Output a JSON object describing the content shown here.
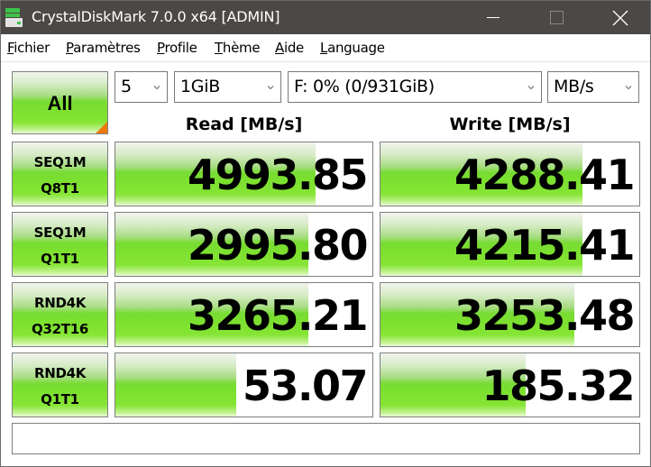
{
  "window": {
    "title": "CrystalDiskMark 7.0.0 x64 [ADMIN]",
    "controls": [
      "minimize",
      "maximize",
      "close"
    ]
  },
  "menu": [
    {
      "label": "Fichier",
      "accel": "F",
      "rest": "ichier"
    },
    {
      "label": "Paramètres",
      "accel": "P",
      "rest": "aramètres"
    },
    {
      "label": "Profile",
      "accel": "P",
      "rest": "rofile"
    },
    {
      "label": "Thème",
      "accel": "T",
      "rest": "hème"
    },
    {
      "label": "Aide",
      "accel": "A",
      "rest": "ide"
    },
    {
      "label": "Language",
      "accel": "L",
      "rest": "anguage"
    }
  ],
  "toolbar": {
    "all_button": "All",
    "count": "5",
    "size": "1GiB",
    "drive": "F: 0% (0/931GiB)",
    "unit": "MB/s"
  },
  "headers": {
    "read": "Read [MB/s]",
    "write": "Write [MB/s]"
  },
  "colors": {
    "accent_orange": "#f0780a",
    "bar_green": "#77dc32",
    "titlebar": "#4b4845"
  },
  "tests": [
    {
      "line1": "SEQ1M",
      "line2": "Q8T1",
      "read": "4993.85",
      "write": "4288.41",
      "read_fill": 0.78,
      "write_fill": 0.78
    },
    {
      "line1": "SEQ1M",
      "line2": "Q1T1",
      "read": "2995.80",
      "write": "4215.41",
      "read_fill": 0.75,
      "write_fill": 0.78
    },
    {
      "line1": "RND4K",
      "line2": "Q32T16",
      "read": "3265.21",
      "write": "3253.48",
      "read_fill": 0.75,
      "write_fill": 0.75
    },
    {
      "line1": "RND4K",
      "line2": "Q1T1",
      "read": "53.07",
      "write": "185.32",
      "read_fill": 0.47,
      "write_fill": 0.56
    }
  ],
  "comment": ""
}
